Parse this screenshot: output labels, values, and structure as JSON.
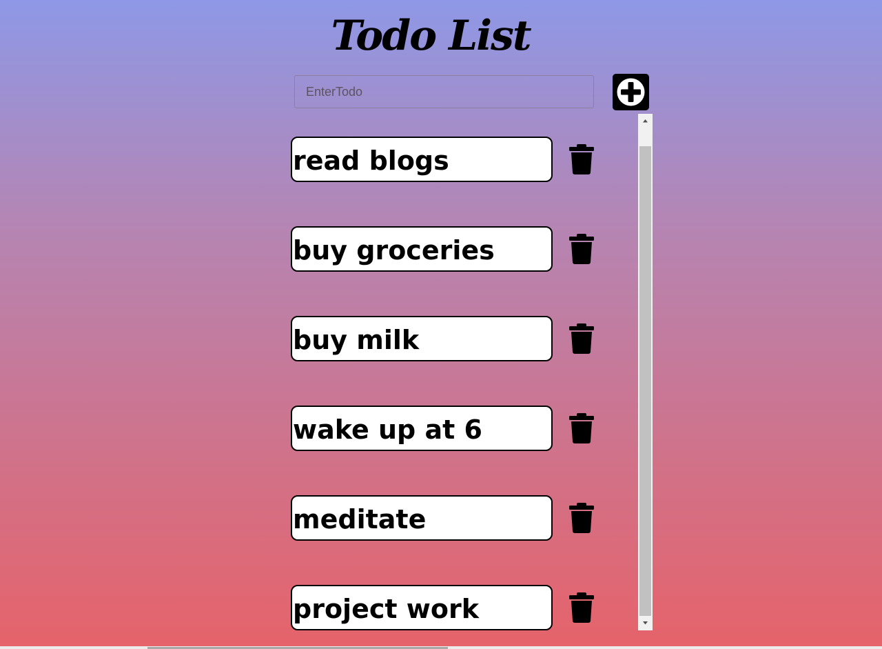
{
  "header": {
    "title": "Todo List"
  },
  "input": {
    "placeholder": "EnterTodo",
    "value": ""
  },
  "add_button": {
    "icon": "plus-icon"
  },
  "todos": [
    {
      "text": "read blogs",
      "delete_icon": "trash-icon"
    },
    {
      "text": "buy groceries",
      "delete_icon": "trash-icon"
    },
    {
      "text": "buy milk",
      "delete_icon": "trash-icon"
    },
    {
      "text": "wake up at 6",
      "delete_icon": "trash-icon"
    },
    {
      "text": "meditate",
      "delete_icon": "trash-icon"
    },
    {
      "text": "project work",
      "delete_icon": "trash-icon"
    }
  ],
  "colors": {
    "gradient_top": "#8e98e6",
    "gradient_bottom": "#e6636a",
    "item_background": "#ffffff",
    "accent": "#000000"
  }
}
